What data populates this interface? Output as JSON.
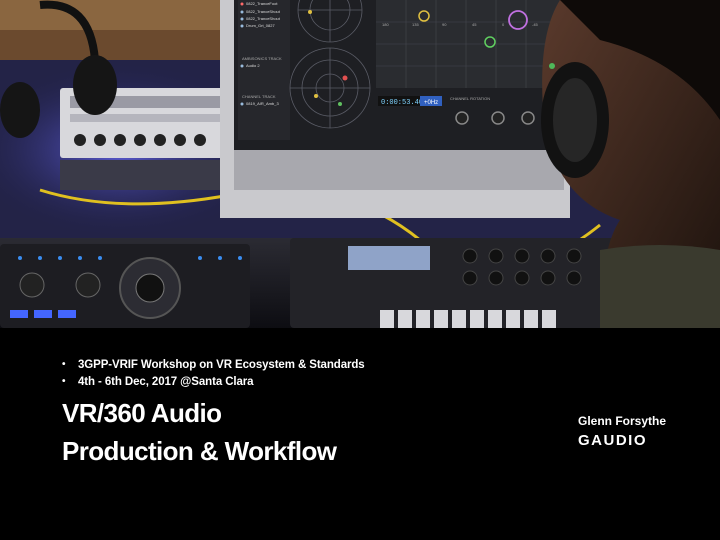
{
  "slide": {
    "bullets": [
      "3GPP-VRIF Workshop on VR Ecosystem & Standards",
      "4th - 6th Dec, 2017 @Santa Clara"
    ],
    "title_line1": "VR/360 Audio",
    "title_line2": "Production & Workflow",
    "presenter": "Glenn Forsythe",
    "logo": "GAUDIO"
  },
  "monitor": {
    "tracks": [
      "0822_TranceFoot",
      "0822_TranceShout",
      "0822_TranceShout",
      "Drum_Grt_0827"
    ],
    "ambisonics_label": "AMBISONICS TRACK",
    "ambisonics_track": "Audio 2",
    "channel_label": "CHANNEL TRACK",
    "channel_track": "0819_AIR_Amb_3",
    "timecode": "0:00:53.40",
    "rate": "+0Hz",
    "rotation_label": "CHANNEL ROTATION",
    "grid_ticks": [
      "180",
      "135",
      "90",
      "45",
      "0",
      "-45"
    ]
  },
  "icons": {
    "bullet": "bullet-icon"
  },
  "colors": {
    "background": "#000000",
    "text": "#ffffff"
  }
}
